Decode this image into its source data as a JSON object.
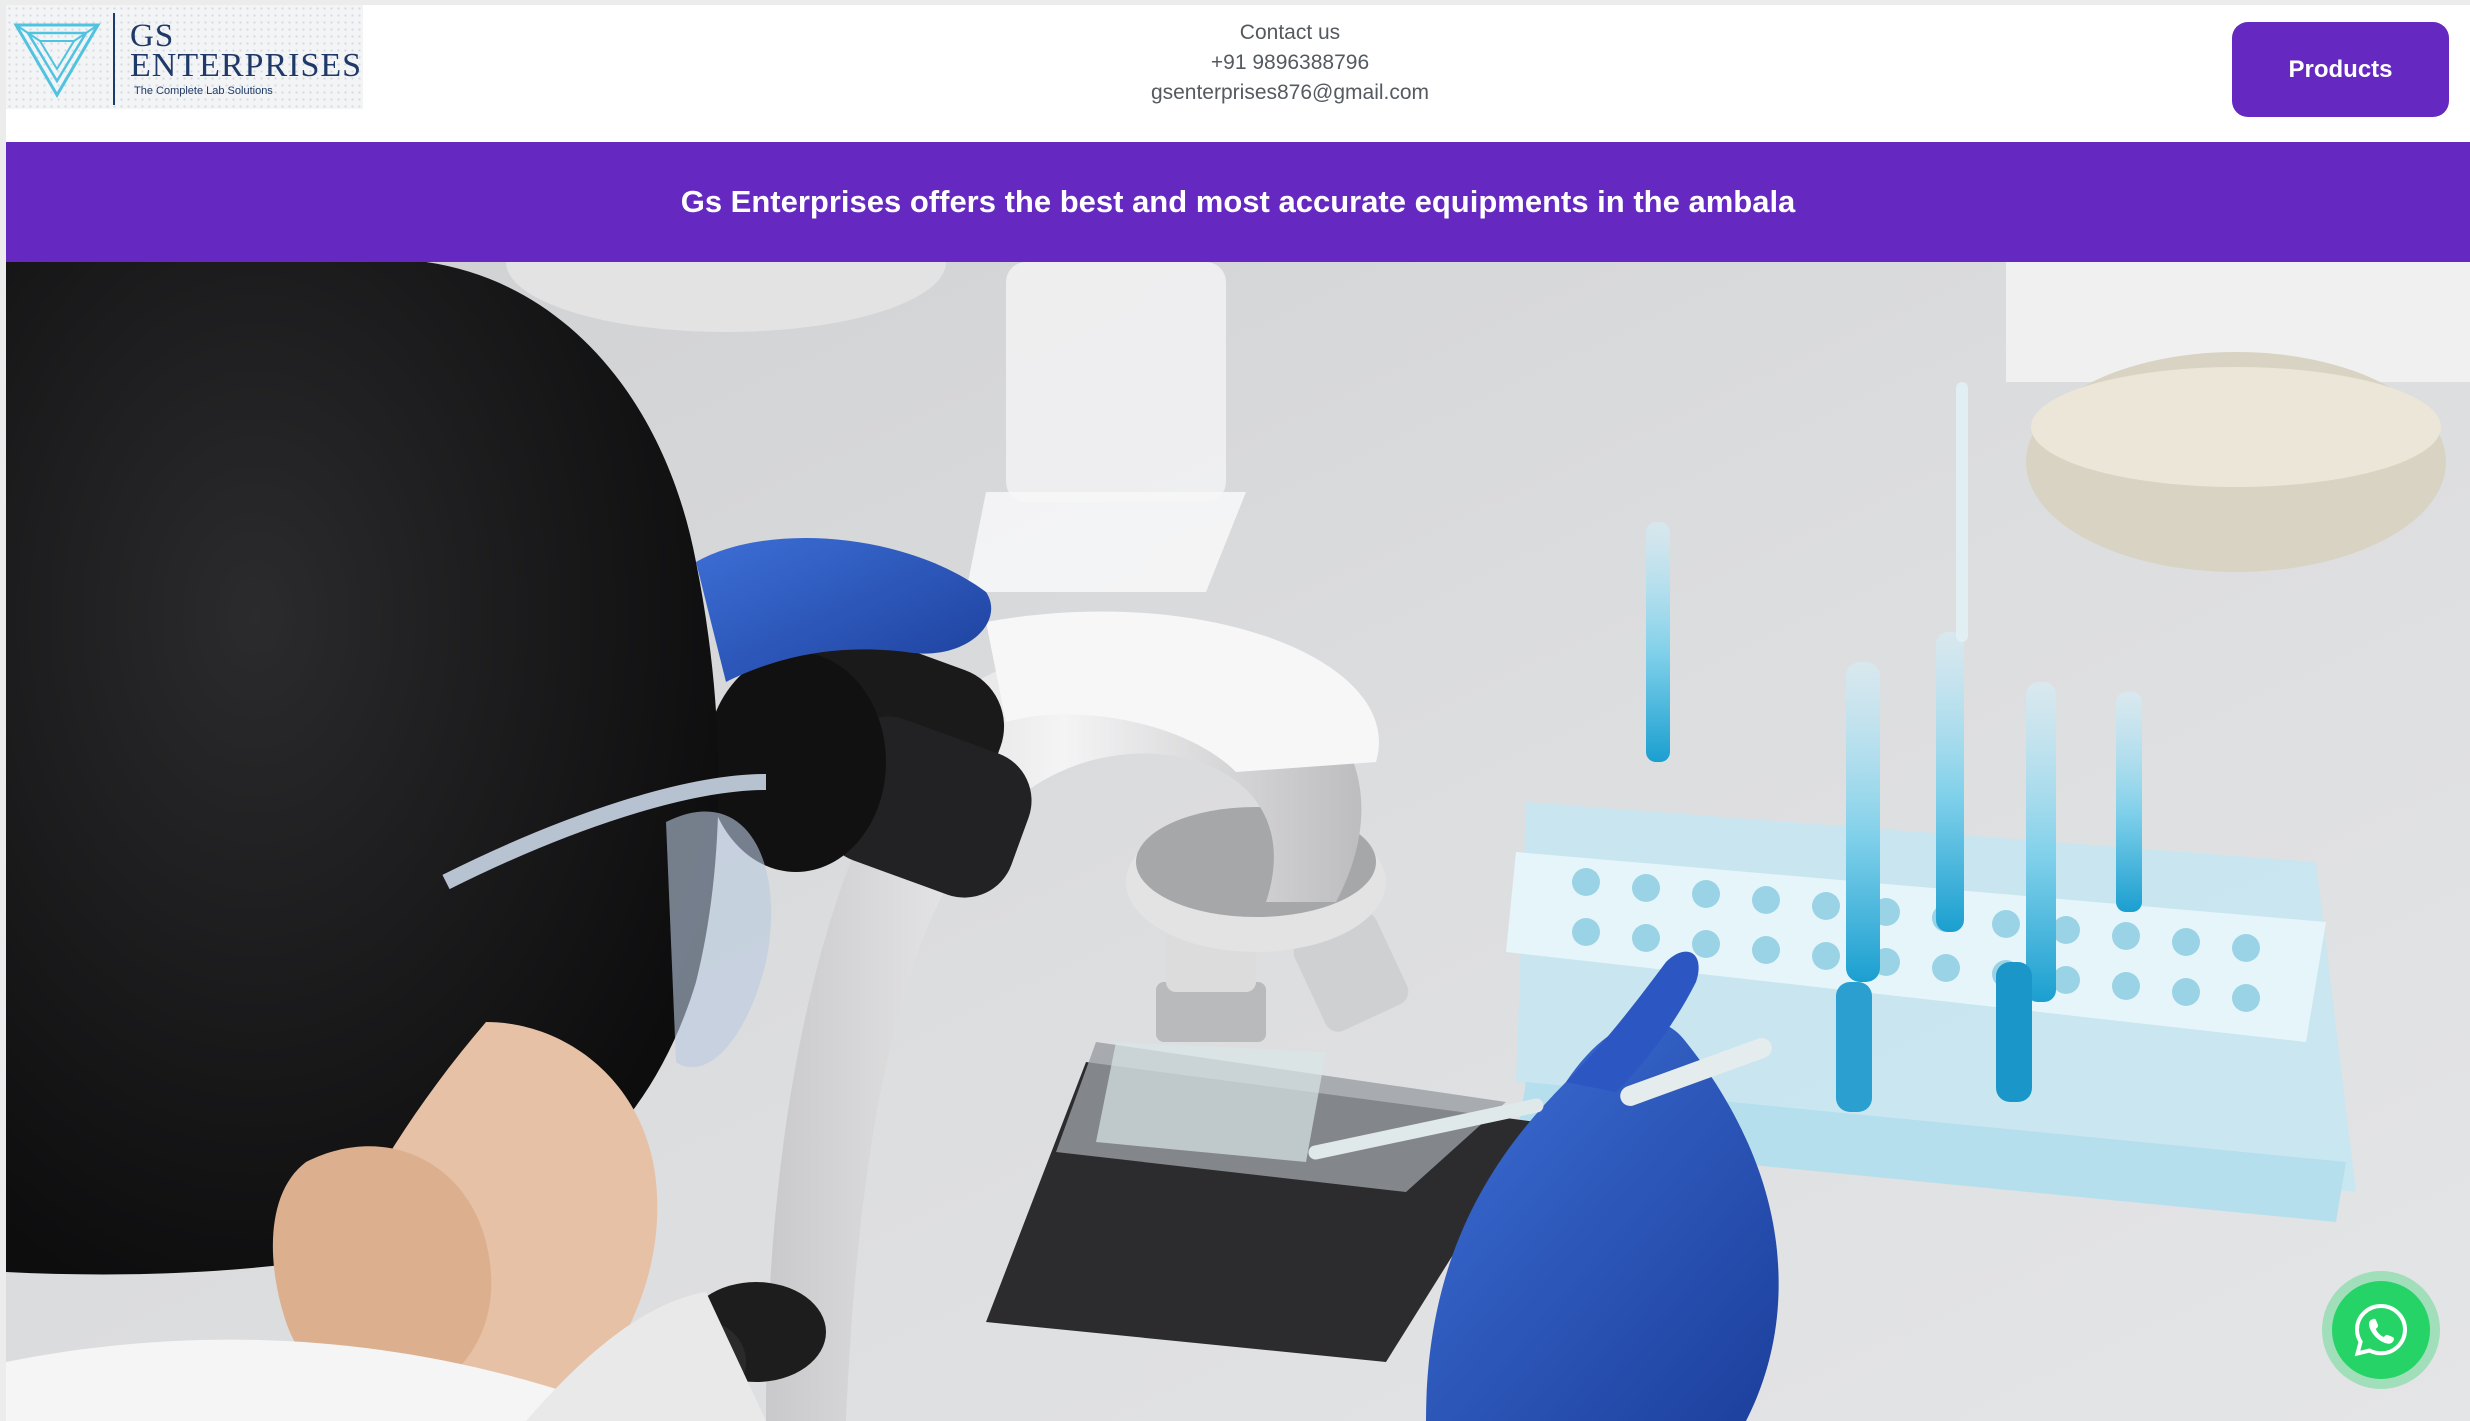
{
  "brand": {
    "name_line1": "GS",
    "name_line2": "ENTERPRISES",
    "tagline": "The Complete Lab Solutions"
  },
  "contact": {
    "heading": "Contact us",
    "phone": "+91 9896388796",
    "email": "gsenterprises876@gmail.com"
  },
  "nav": {
    "products_label": "Products"
  },
  "banner": {
    "text": "Gs Enterprises offers the best and most accurate equipments in the ambala"
  },
  "hero": {
    "image": "scientist-looking-into-microscope-with-test-tube-rack"
  },
  "icons": {
    "logo": "triangle-logo-icon",
    "chat": "whatsapp-icon"
  },
  "colors": {
    "brand_purple": "#6528c0",
    "whatsapp_green": "#25d366",
    "logo_navy": "#1f3a68"
  }
}
